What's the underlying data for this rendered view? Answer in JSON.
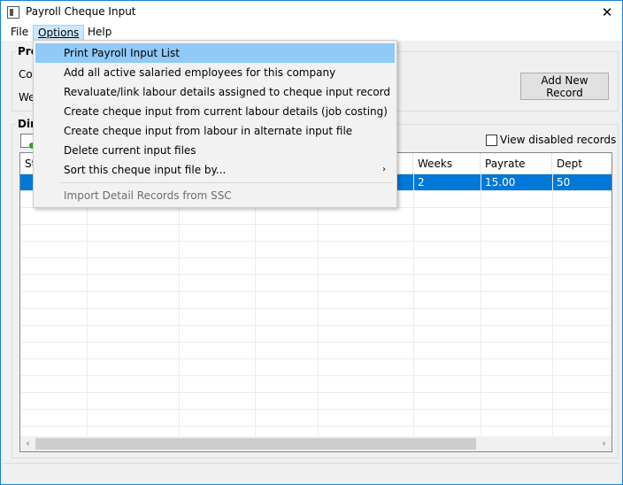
{
  "window": {
    "title": "Payroll Cheque Input",
    "close_glyph": "✕"
  },
  "menubar": {
    "items": [
      {
        "label": "File"
      },
      {
        "label": "Options"
      },
      {
        "label": "Help"
      }
    ]
  },
  "group_top": {
    "title": "Pro",
    "label_company": "Co",
    "label_week": "We",
    "add_button": "Add New Record"
  },
  "group_detail": {
    "title": "Dir",
    "view_disabled": "View disabled records",
    "view_disabled_checked": false
  },
  "grid": {
    "columns": [
      {
        "label": "St"
      },
      {
        "label": ""
      },
      {
        "label": ""
      },
      {
        "label": ""
      },
      {
        "label": ""
      },
      {
        "label": "Weeks"
      },
      {
        "label": "Payrate"
      },
      {
        "label": "Dept"
      }
    ],
    "rows": [
      {
        "selected": true,
        "cells": [
          "",
          "",
          "",
          "",
          "",
          "2",
          "15.00",
          "50"
        ]
      }
    ]
  },
  "options_menu": {
    "items": [
      {
        "label": "Print Payroll Input List"
      },
      {
        "label": "Add all active salaried employees for this company"
      },
      {
        "label": "Revaluate/link labour details assigned to cheque input record"
      },
      {
        "label": "Create cheque input from current labour details (job costing)"
      },
      {
        "label": "Create cheque input from labour in alternate input file"
      },
      {
        "label": "Delete current input files"
      },
      {
        "label": "Sort this cheque input file by..."
      },
      {
        "label": "Import Detail Records from SSC"
      }
    ],
    "submenu_glyph": "›"
  },
  "icons": {
    "scroll_left": "‹",
    "scroll_right": "›"
  },
  "colors": {
    "selection": "#0078d7",
    "menu_highlight": "#91c9f7",
    "window_border": "#1883d7"
  }
}
